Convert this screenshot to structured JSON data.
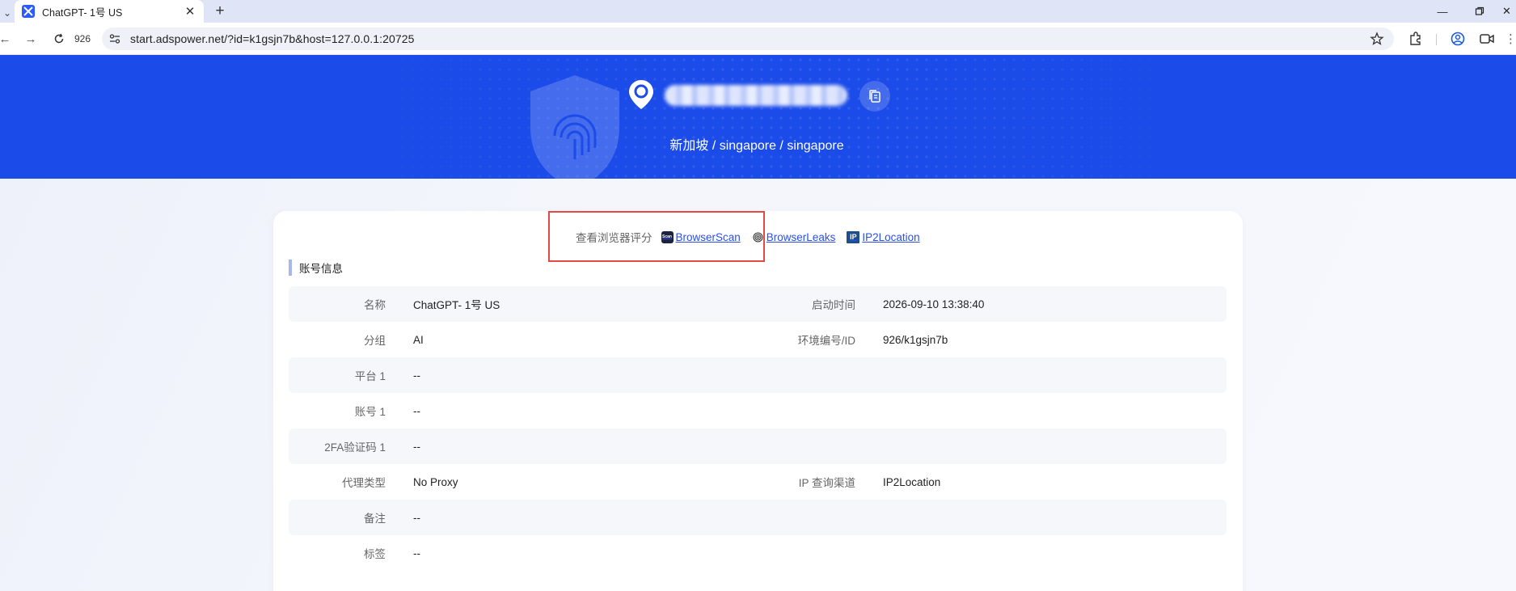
{
  "browser": {
    "tab": {
      "title": "ChatGPT- 1号 US"
    },
    "tab_count": "926",
    "url": "start.adspower.net/?id=k1gsjn7b&host=127.0.0.1:20725"
  },
  "banner": {
    "location": "新加坡 / singapore / singapore"
  },
  "score_bar": {
    "label": "查看浏览器评分",
    "links": [
      "BrowserScan",
      "BrowserLeaks",
      "IP2Location"
    ],
    "icon_text": {
      "browserscan": "Scan",
      "ip2location": "IP"
    }
  },
  "account": {
    "section_title": "账号信息",
    "rows": [
      {
        "label": "名称",
        "value": "ChatGPT- 1号 US",
        "label2": "启动时间",
        "value2": "2026-09-10 13:38:40"
      },
      {
        "label": "分组",
        "value": "AI",
        "label2": "环境编号/ID",
        "value2": "926/k1gsjn7b"
      },
      {
        "label": "平台 1",
        "value": "--",
        "label2": "",
        "value2": ""
      },
      {
        "label": "账号 1",
        "value": "--",
        "label2": "",
        "value2": ""
      },
      {
        "label": "2FA验证码 1",
        "value": "--",
        "label2": "",
        "value2": ""
      },
      {
        "label": "代理类型",
        "value": "No Proxy",
        "label2": "IP 查询渠道",
        "value2": "IP2Location"
      },
      {
        "label": "备注",
        "value": "--",
        "label2": "",
        "value2": ""
      },
      {
        "label": "标签",
        "value": "--",
        "label2": "",
        "value2": ""
      }
    ]
  },
  "colors": {
    "banner": "#1b4be8",
    "link": "#2a50e6",
    "highlight": "#e34a44",
    "accent_bar": "#a8b6ef"
  }
}
